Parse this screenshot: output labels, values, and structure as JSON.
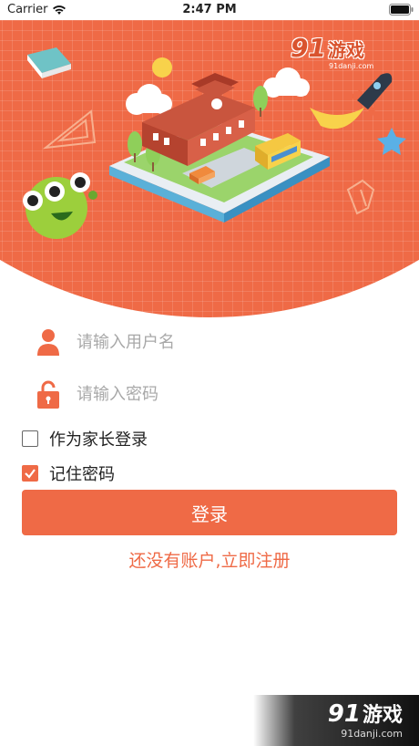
{
  "status_bar": {
    "carrier": "Carrier",
    "time": "2:47 PM"
  },
  "header": {
    "logo_number": "91",
    "logo_text": "游戏",
    "logo_sub": "91danji.com"
  },
  "form": {
    "username_placeholder": "请输入用户名",
    "password_placeholder": "请输入密码",
    "parent_login_label": "作为家长登录",
    "parent_login_checked": false,
    "remember_label": "记住密码",
    "remember_checked": true,
    "login_button": "登录",
    "register_link": "还没有账户,立即注册"
  },
  "watermark": {
    "number": "91",
    "text": "游戏",
    "sub": "91danji.com"
  },
  "colors": {
    "accent": "#ef6a46",
    "placeholder": "#a8a8a8"
  }
}
